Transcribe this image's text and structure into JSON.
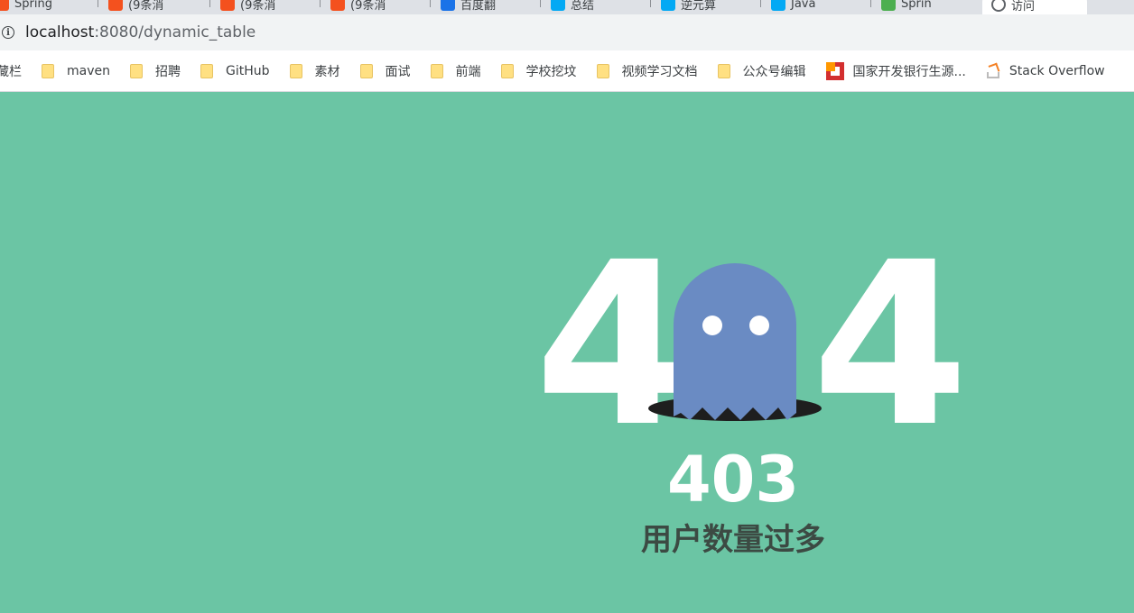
{
  "browser": {
    "tabs": [
      {
        "label": "Spring",
        "favicon_color": "#f4511e"
      },
      {
        "label": "(9条消",
        "favicon_color": "#f4511e"
      },
      {
        "label": "(9条消",
        "favicon_color": "#f4511e"
      },
      {
        "label": "(9条消",
        "favicon_color": "#f4511e"
      },
      {
        "label": "百度翻",
        "favicon_color": "#1a73e8"
      },
      {
        "label": "总结",
        "favicon_color": "#03a9f4"
      },
      {
        "label": "逆元算",
        "favicon_color": "#03a9f4"
      },
      {
        "label": "Java",
        "favicon_color": "#03a9f4"
      },
      {
        "label": "Sprin",
        "favicon_color": "#4caf50"
      },
      {
        "label": "访问",
        "favicon_color": "#5f6368",
        "active": true
      }
    ],
    "address": {
      "host": "localhost",
      "path": ":8080/dynamic_table"
    },
    "bookmarks": [
      {
        "label": "藏栏",
        "icon": "none"
      },
      {
        "label": "maven",
        "icon": "folder-icon"
      },
      {
        "label": "招聘",
        "icon": "folder-icon"
      },
      {
        "label": "GitHub",
        "icon": "folder-icon"
      },
      {
        "label": "素材",
        "icon": "folder-icon"
      },
      {
        "label": "面试",
        "icon": "folder-icon"
      },
      {
        "label": "前端",
        "icon": "folder-icon"
      },
      {
        "label": "学校挖坟",
        "icon": "folder-icon"
      },
      {
        "label": "视频学习文档",
        "icon": "folder-icon"
      },
      {
        "label": "公众号编辑",
        "icon": "folder-icon"
      },
      {
        "label": "国家开发银行生源...",
        "icon": "bank-icon"
      },
      {
        "label": "Stack Overflow",
        "icon": "stackoverflow-icon"
      }
    ]
  },
  "page": {
    "background": "#6bc5a4",
    "digit_left": "4",
    "digit_right": "4",
    "ghost_color": "#6a8bc3",
    "status_code": "403",
    "message": "用户数量过多"
  }
}
